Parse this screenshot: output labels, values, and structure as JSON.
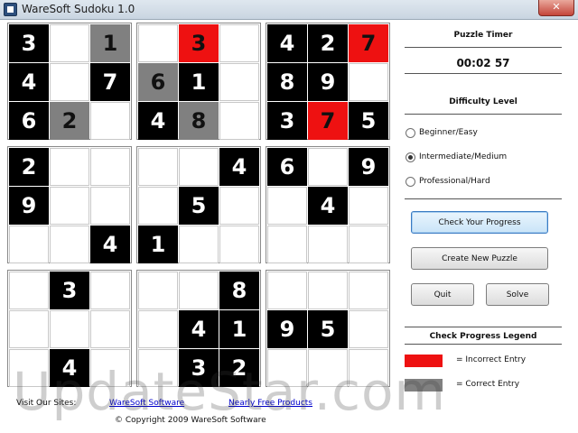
{
  "window": {
    "title": "WareSoft Sudoku 1.0",
    "close_label": "✕"
  },
  "board": {
    "rows": [
      [
        {
          "v": "3",
          "s": "given"
        },
        {
          "v": "",
          "s": "empty"
        },
        {
          "v": "1",
          "s": "correct"
        },
        {
          "v": "",
          "s": "empty"
        },
        {
          "v": "3",
          "s": "incorrect"
        },
        {
          "v": "",
          "s": "empty"
        },
        {
          "v": "4",
          "s": "given"
        },
        {
          "v": "2",
          "s": "given"
        },
        {
          "v": "7",
          "s": "incorrect"
        }
      ],
      [
        {
          "v": "4",
          "s": "given"
        },
        {
          "v": "",
          "s": "empty"
        },
        {
          "v": "7",
          "s": "given"
        },
        {
          "v": "6",
          "s": "correct"
        },
        {
          "v": "1",
          "s": "given"
        },
        {
          "v": "",
          "s": "empty"
        },
        {
          "v": "8",
          "s": "given"
        },
        {
          "v": "9",
          "s": "given"
        },
        {
          "v": "",
          "s": "empty"
        }
      ],
      [
        {
          "v": "6",
          "s": "given"
        },
        {
          "v": "2",
          "s": "correct"
        },
        {
          "v": "",
          "s": "empty"
        },
        {
          "v": "4",
          "s": "given"
        },
        {
          "v": "8",
          "s": "correct"
        },
        {
          "v": "",
          "s": "empty"
        },
        {
          "v": "3",
          "s": "given"
        },
        {
          "v": "7",
          "s": "incorrect"
        },
        {
          "v": "5",
          "s": "given"
        }
      ],
      [
        {
          "v": "2",
          "s": "given"
        },
        {
          "v": "",
          "s": "empty"
        },
        {
          "v": "",
          "s": "empty"
        },
        {
          "v": "",
          "s": "empty"
        },
        {
          "v": "",
          "s": "empty"
        },
        {
          "v": "4",
          "s": "given"
        },
        {
          "v": "6",
          "s": "given"
        },
        {
          "v": "",
          "s": "empty"
        },
        {
          "v": "9",
          "s": "given"
        }
      ],
      [
        {
          "v": "9",
          "s": "given"
        },
        {
          "v": "",
          "s": "empty"
        },
        {
          "v": "",
          "s": "empty"
        },
        {
          "v": "",
          "s": "empty"
        },
        {
          "v": "5",
          "s": "given"
        },
        {
          "v": "",
          "s": "empty"
        },
        {
          "v": "",
          "s": "empty"
        },
        {
          "v": "4",
          "s": "given"
        },
        {
          "v": "",
          "s": "empty"
        }
      ],
      [
        {
          "v": "",
          "s": "empty"
        },
        {
          "v": "",
          "s": "empty"
        },
        {
          "v": "4",
          "s": "given"
        },
        {
          "v": "1",
          "s": "given"
        },
        {
          "v": "",
          "s": "empty"
        },
        {
          "v": "",
          "s": "empty"
        },
        {
          "v": "",
          "s": "empty"
        },
        {
          "v": "",
          "s": "empty"
        },
        {
          "v": "",
          "s": "empty"
        }
      ],
      [
        {
          "v": "",
          "s": "empty"
        },
        {
          "v": "3",
          "s": "given"
        },
        {
          "v": "",
          "s": "empty"
        },
        {
          "v": "",
          "s": "empty"
        },
        {
          "v": "",
          "s": "empty"
        },
        {
          "v": "8",
          "s": "given"
        },
        {
          "v": "",
          "s": "empty"
        },
        {
          "v": "",
          "s": "empty"
        },
        {
          "v": "",
          "s": "empty"
        }
      ],
      [
        {
          "v": "",
          "s": "empty"
        },
        {
          "v": "",
          "s": "empty"
        },
        {
          "v": "",
          "s": "empty"
        },
        {
          "v": "",
          "s": "empty"
        },
        {
          "v": "4",
          "s": "given"
        },
        {
          "v": "1",
          "s": "given"
        },
        {
          "v": "9",
          "s": "given"
        },
        {
          "v": "5",
          "s": "given"
        },
        {
          "v": "",
          "s": "empty"
        }
      ],
      [
        {
          "v": "",
          "s": "empty"
        },
        {
          "v": "4",
          "s": "given"
        },
        {
          "v": "",
          "s": "empty"
        },
        {
          "v": "",
          "s": "empty"
        },
        {
          "v": "3",
          "s": "given"
        },
        {
          "v": "2",
          "s": "given"
        },
        {
          "v": "",
          "s": "empty"
        },
        {
          "v": "",
          "s": "empty"
        },
        {
          "v": "",
          "s": "empty"
        }
      ]
    ]
  },
  "panel": {
    "timer_heading": "Puzzle Timer",
    "timer_value": "00:02 57",
    "difficulty_heading": "Difficulty Level",
    "difficulty_options": [
      {
        "label": "Beginner/Easy",
        "checked": false
      },
      {
        "label": "Intermediate/Medium",
        "checked": true
      },
      {
        "label": "Professional/Hard",
        "checked": false
      }
    ],
    "check_progress_label": "Check Your Progress",
    "new_puzzle_label": "Create New Puzzle",
    "quit_label": "Quit",
    "solve_label": "Solve",
    "legend_heading": "Check Progress Legend",
    "legend": [
      {
        "color": "#ee1111",
        "label": "= Incorrect Entry"
      },
      {
        "color": "#808080",
        "label": "= Correct Entry"
      }
    ]
  },
  "footer": {
    "visit_label": "Visit Our Sites:",
    "link1": "WareSoft Software",
    "link2": "Nearly Free Products",
    "copyright": "© Copyright 2009 WareSoft Software"
  },
  "watermark": "UpdateStar.com"
}
